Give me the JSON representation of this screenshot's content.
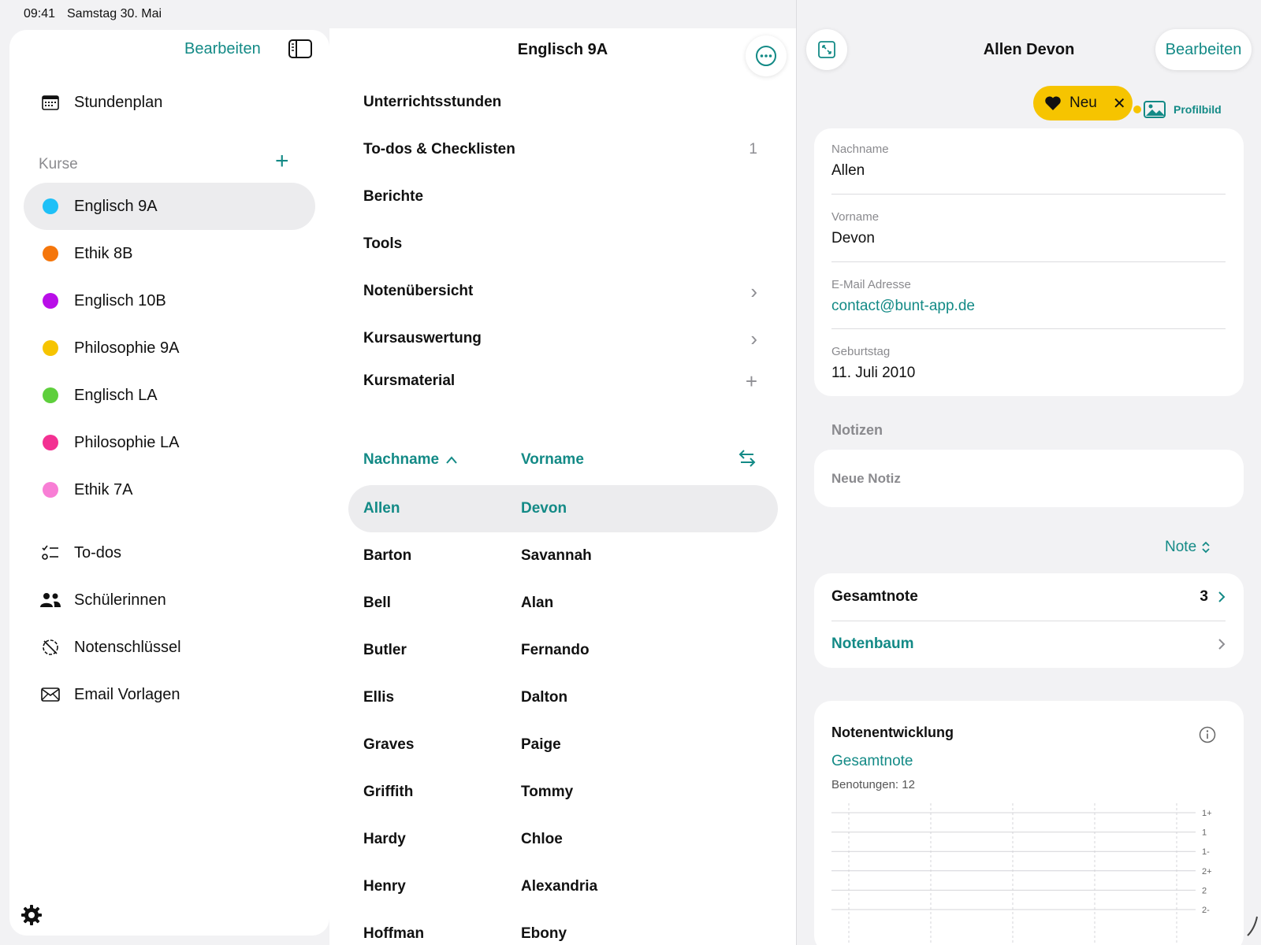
{
  "status": {
    "time": "09:41",
    "date": "Samstag 30. Mai"
  },
  "sidebar": {
    "edit_label": "Bearbeiten",
    "schedule_label": "Stundenplan",
    "courses_title": "Kurse",
    "courses": [
      {
        "label": "Englisch 9A",
        "color": "#1ec0f7"
      },
      {
        "label": "Ethik 8B",
        "color": "#f5760b"
      },
      {
        "label": "Englisch 10B",
        "color": "#b90ee8"
      },
      {
        "label": "Philosophie 9A",
        "color": "#f6c400"
      },
      {
        "label": "Englisch LA",
        "color": "#5ecf3c"
      },
      {
        "label": "Philosophie LA",
        "color": "#f33192"
      },
      {
        "label": "Ethik 7A",
        "color": "#f87ed5"
      }
    ],
    "todos_label": "To-dos",
    "students_label": "Schülerinnen",
    "gradekey_label": "Notenschlüssel",
    "email_label": "Email Vorlagen"
  },
  "course": {
    "title": "Englisch 9A",
    "menu": [
      {
        "label": "Unterrichtsstunden",
        "right": ""
      },
      {
        "label": "To-dos & Checklisten",
        "right": "1"
      },
      {
        "label": "Berichte",
        "right": ""
      },
      {
        "label": "Tools",
        "right": ""
      },
      {
        "label": "Notenübersicht",
        "right": "›"
      },
      {
        "label": "Kursauswertung",
        "right": "›"
      },
      {
        "label": "Kursmaterial",
        "right": "+"
      }
    ],
    "col_lastname": "Nachname",
    "col_firstname": "Vorname",
    "students": [
      {
        "last": "Allen",
        "first": "Devon"
      },
      {
        "last": "Barton",
        "first": "Savannah"
      },
      {
        "last": "Bell",
        "first": "Alan"
      },
      {
        "last": "Butler",
        "first": "Fernando"
      },
      {
        "last": "Ellis",
        "first": "Dalton"
      },
      {
        "last": "Graves",
        "first": "Paige"
      },
      {
        "last": "Griffith",
        "first": "Tommy"
      },
      {
        "last": "Hardy",
        "first": "Chloe"
      },
      {
        "last": "Henry",
        "first": "Alexandria"
      },
      {
        "last": "Hoffman",
        "first": "Ebony"
      }
    ]
  },
  "detail": {
    "title": "Allen Devon",
    "edit_label": "Bearbeiten",
    "tag_label": "Neu",
    "profile_label": "Profilbild",
    "fields": {
      "lastname_label": "Nachname",
      "lastname": "Allen",
      "firstname_label": "Vorname",
      "firstname": "Devon",
      "email_label": "E-Mail Adresse",
      "email": "contact@bunt-app.de",
      "birthday_label": "Geburtstag",
      "birthday": "11. Juli 2010"
    },
    "notes_title": "Notizen",
    "new_note_placeholder": "Neue Notiz",
    "grade_selector": "Note",
    "overall_grade_label": "Gesamtnote",
    "overall_grade_value": "3",
    "grade_tree_label": "Notenbaum",
    "development_title": "Notenentwicklung",
    "development_sub": "Gesamtnote",
    "development_count": "Benotungen: 12"
  },
  "chart_data": {
    "type": "line",
    "y_tick_labels": [
      "1+",
      "1",
      "1-",
      "2+",
      "2",
      "2-"
    ],
    "series": [],
    "grid": true
  },
  "colors": {
    "accent": "#138a86",
    "tag": "#f6c400"
  }
}
